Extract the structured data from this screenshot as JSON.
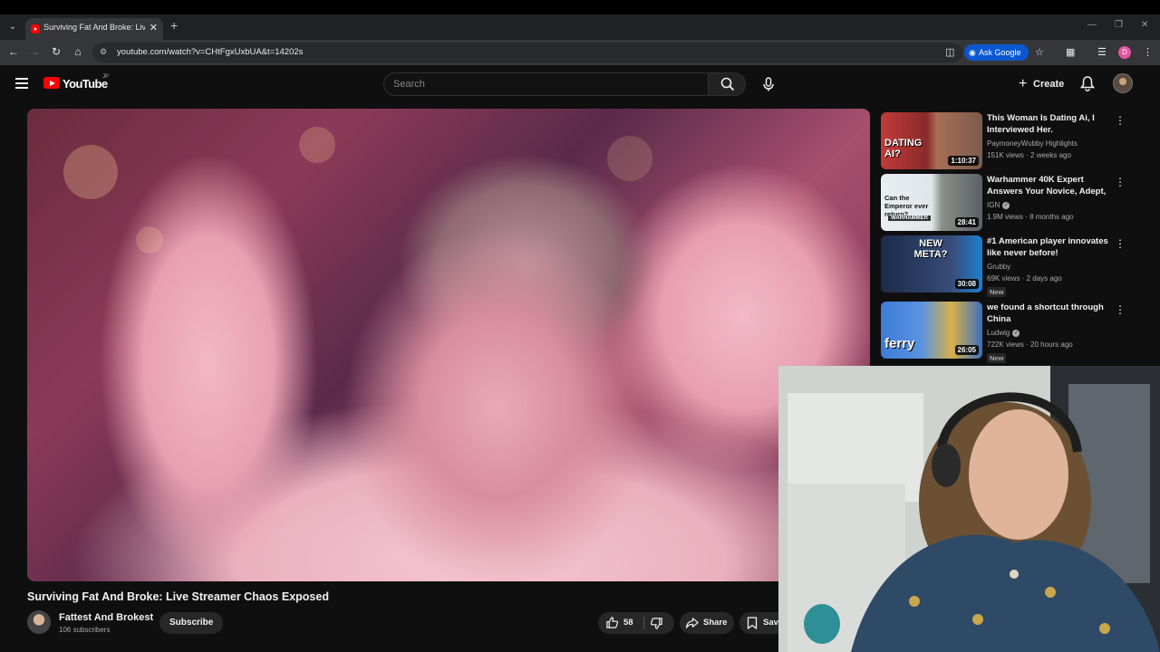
{
  "browser": {
    "tab_title": "Surviving Fat And Broke: Live St",
    "url": "youtube.com/watch?v=CHtFgxUxbUA&t=14202s",
    "ask_google_label": "Ask Google",
    "profile_initial": "D"
  },
  "masthead": {
    "logo_text": "YouTube",
    "region": "JP",
    "search_placeholder": "Search",
    "create_label": "Create"
  },
  "video": {
    "title": "Surviving Fat And Broke: Live Streamer Chaos Exposed",
    "channel_name": "Fattest And Brokest",
    "subscribers": "106 subscribers",
    "subscribe_label": "Subscribe",
    "like_count": "58",
    "share_label": "Share",
    "save_label": "Save"
  },
  "recommendations": [
    {
      "title": "This Woman Is Dating Ai, I Interviewed Her.",
      "channel": "PaymoneyWubby Highlights",
      "verified": false,
      "meta": "151K views · 2 weeks ago",
      "duration": "1:10:37",
      "thumb_text": "DATING AI?",
      "new": ""
    },
    {
      "title": "Warhammer 40K Expert Answers Your Novice, Adept, ...",
      "channel": "IGN",
      "verified": true,
      "meta": "1.9M views · 8 months ago",
      "duration": "28:41",
      "thumb_text": "Can the Emperor ever return?",
      "thumb_sub": "WARHAMMER",
      "new": ""
    },
    {
      "title": "#1 American player innovates like never before!",
      "channel": "Grubby",
      "verified": false,
      "meta": "69K views · 2 days ago",
      "duration": "30:08",
      "thumb_text": "NEW META?",
      "new": "New"
    },
    {
      "title": "we found a shortcut through China",
      "channel": "Ludwig",
      "verified": true,
      "meta": "722K views · 20 hours ago",
      "duration": "26:05",
      "thumb_text": "ferry",
      "new": "New"
    }
  ],
  "colors": {
    "background": "#0f0f0f",
    "brand_red": "#ff0000",
    "ask_google_blue": "#0b57d0"
  }
}
